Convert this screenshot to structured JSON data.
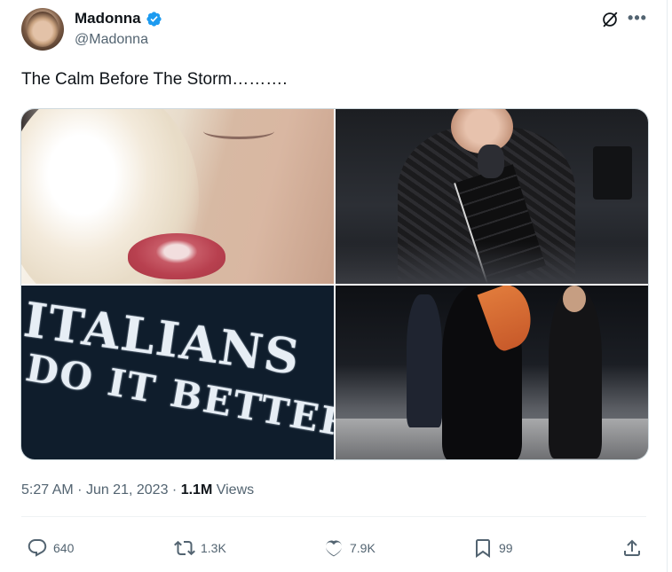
{
  "tweet": {
    "author_name": "Madonna",
    "author_handle": "@Madonna",
    "text": "The Calm Before The Storm……….",
    "media": {
      "image1": "close-up-face-photo",
      "image2": "shh-gesture-photo",
      "image3": "italians-do-it-better-shirt-photo",
      "image3_text_line1": "ITALIANS",
      "image3_text_line2": "DO IT BETTER",
      "image4": "stage-rehearsal-photo"
    },
    "time": "5:27 AM",
    "date": "Jun 21, 2023",
    "views_count": "1.1M",
    "views_label": "Views",
    "separator": "·"
  },
  "actions": {
    "replies": "640",
    "retweets": "1.3K",
    "likes": "7.9K",
    "bookmarks": "99"
  },
  "colors": {
    "verified": "#1d9bf0",
    "text_secondary": "#536471",
    "text_primary": "#0f1419"
  },
  "icons": {
    "verified": "verified-badge-icon",
    "grok": "grok-icon",
    "more": "more-icon",
    "reply": "reply-icon",
    "retweet": "retweet-icon",
    "like": "heart-icon",
    "bookmark": "bookmark-icon",
    "share": "share-icon"
  }
}
